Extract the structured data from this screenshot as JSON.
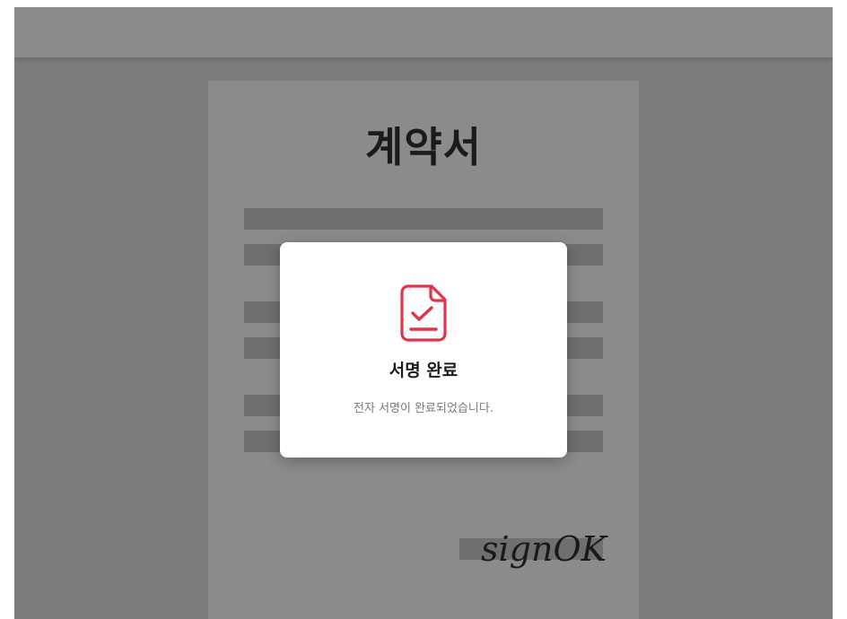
{
  "document": {
    "title": "계약서",
    "signature": "signOK",
    "line_count": 6
  },
  "modal": {
    "icon": "document-check-icon",
    "icon_color": "#e0344a",
    "title": "서명 완료",
    "message": "전자 서명이 완료되었습니다."
  },
  "colors": {
    "overlay_bg": "#7c7c7c",
    "paper_bg": "#8b8b8b",
    "text_line": "#6f6f6f",
    "accent": "#e0344a"
  }
}
